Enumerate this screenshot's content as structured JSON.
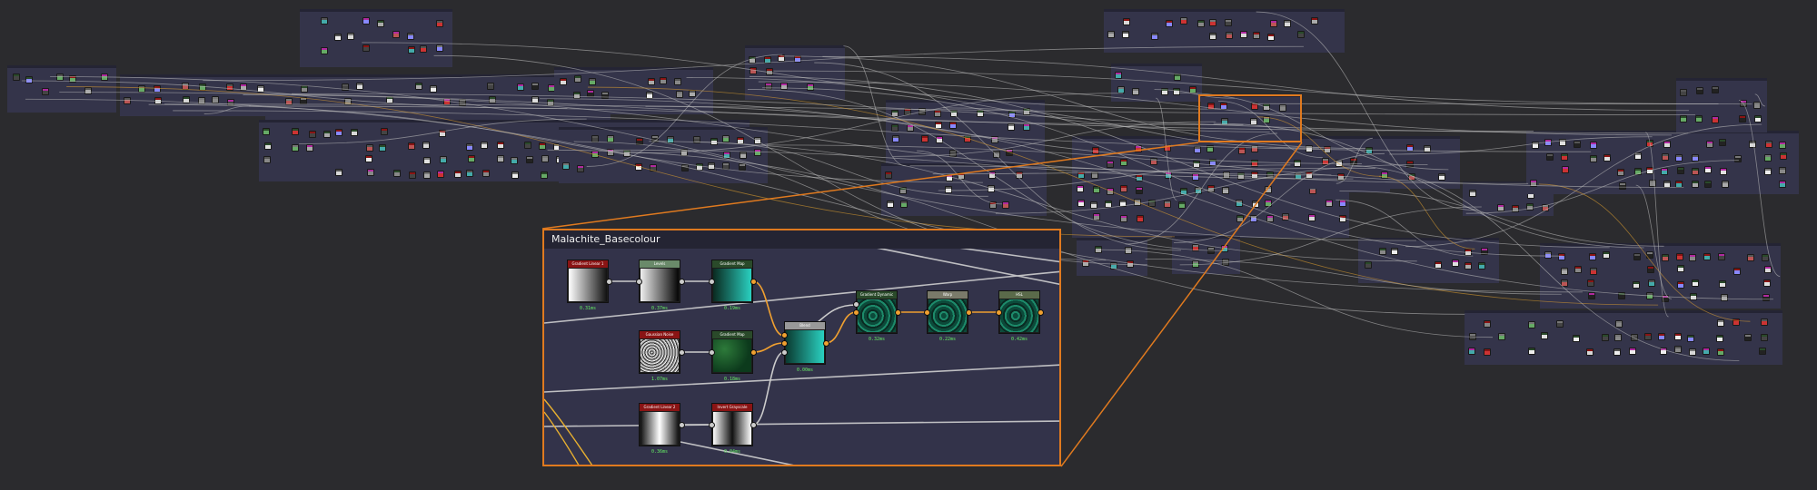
{
  "inset": {
    "title": "Malachite_Basecolour",
    "nodes": [
      {
        "id": "n1",
        "label": "Gradient Linear 1",
        "header": "#8a1414",
        "body": "gradh",
        "time": "0.31ms"
      },
      {
        "id": "n2",
        "label": "Levels",
        "header": "#6a8a6a",
        "body": "gradh2",
        "time": "0.37ms"
      },
      {
        "id": "n3",
        "label": "Gradient Map",
        "header": "#2a4a2a",
        "body": "teal",
        "time": "0.19ms"
      },
      {
        "id": "n4",
        "label": "Gaussian Noise",
        "header": "#8a1414",
        "body": "noise",
        "time": "1.07ms"
      },
      {
        "id": "n5",
        "label": "Gradient Map",
        "header": "#2a4a2a",
        "body": "green",
        "time": "0.18ms"
      },
      {
        "id": "n6",
        "label": "Blend",
        "header": "#999999",
        "body": "teal2",
        "time": "0.00ms"
      },
      {
        "id": "n7",
        "label": "Gradient Dynamic",
        "header": "#2a4a2a",
        "body": "mal",
        "time": "0.32ms"
      },
      {
        "id": "n8",
        "label": "Warp",
        "header": "#7a7a6a",
        "body": "mal",
        "time": "0.22ms"
      },
      {
        "id": "n9",
        "label": "HSL",
        "header": "#5a6a4a",
        "body": "mal",
        "time": "0.42ms"
      },
      {
        "id": "n10",
        "label": "Gradient Linear 2",
        "header": "#8a1414",
        "body": "gradc",
        "time": "0.36ms"
      },
      {
        "id": "n11",
        "label": "Invert Grayscale",
        "header": "#8a1414",
        "body": "gradinv",
        "time": "0.04ms"
      }
    ]
  },
  "colors": {
    "canvas": "#2b2b2e",
    "frame": "#34344a",
    "highlight": "#e07a1f",
    "time": "#66ee66"
  }
}
